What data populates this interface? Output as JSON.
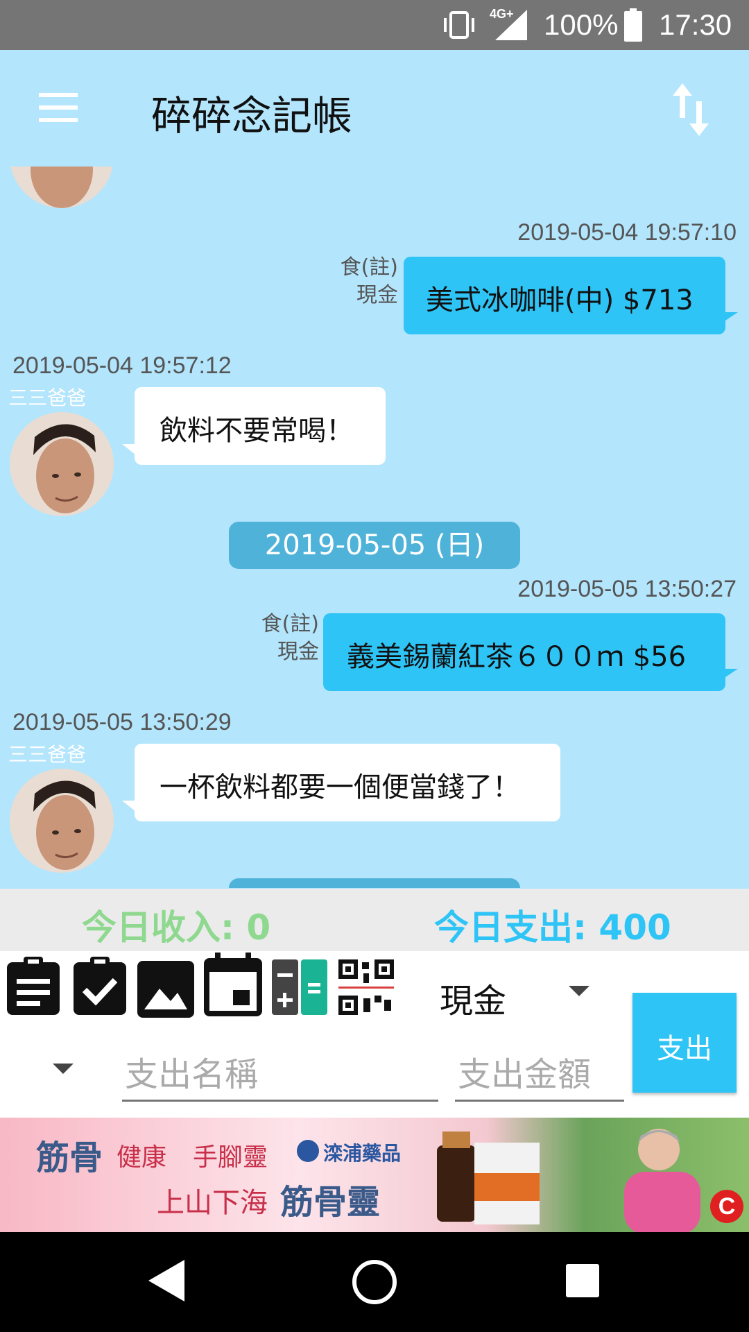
{
  "status_bar": {
    "network": "4G+",
    "battery": "100%",
    "time": "17:30"
  },
  "app_bar": {
    "title": "碎碎念記帳"
  },
  "chat": {
    "messages": [
      {
        "time": "2019-05-04 19:57:10",
        "category": "食(註)",
        "payment": "現金",
        "text": "美式冰咖啡(中) $713"
      },
      {
        "time": "2019-05-04 19:57:12",
        "sender": "三三爸爸",
        "text": "飲料不要常喝！"
      },
      {
        "date": "2019-05-05 (日)"
      },
      {
        "time": "2019-05-05 13:50:27",
        "category": "食(註)",
        "payment": "現金",
        "text": "義美錫蘭紅茶６００ｍ $56"
      },
      {
        "time": "2019-05-05 13:50:29",
        "sender": "三三爸爸",
        "text": "一杯飲料都要一個便當錢了！"
      }
    ]
  },
  "summary": {
    "income_label": "今日收入: 0",
    "expense_label": "今日支出: 400",
    "income_color": "#8fd88f",
    "expense_color": "#2ec4f6"
  },
  "toolbar": {
    "payment_selected": "現金",
    "name_placeholder": "支出名稱",
    "amount_placeholder": "支出金額",
    "submit_label": "支出"
  },
  "ad": {
    "line1a": "筋骨",
    "line1b": "健康",
    "line1c": "手腳靈",
    "brand": "滦浦藥品",
    "line2a": "上山下海",
    "line2b": "筋骨靈"
  }
}
